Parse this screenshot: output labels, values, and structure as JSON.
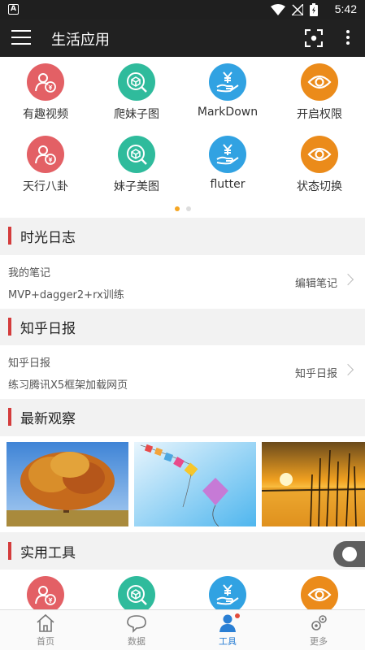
{
  "status_bar": {
    "time": "5:42",
    "app_badge": "A"
  },
  "app_bar": {
    "title": "生活应用"
  },
  "grid": {
    "items": [
      {
        "label": "有趣视频",
        "icon": "user-money-icon",
        "color": "#e36065"
      },
      {
        "label": "爬妹子图",
        "icon": "box-search-icon",
        "color": "#2fbb9c"
      },
      {
        "label": "MarkDown",
        "icon": "yen-hand-icon",
        "color": "#31a2e2"
      },
      {
        "label": "开启权限",
        "icon": "eye-icon",
        "color": "#eb8b1a"
      },
      {
        "label": "天行八卦",
        "icon": "user-money-icon",
        "color": "#e36065"
      },
      {
        "label": "妹子美图",
        "icon": "box-search-icon",
        "color": "#2fbb9c"
      },
      {
        "label": "flutter",
        "icon": "yen-hand-icon",
        "color": "#31a2e2"
      },
      {
        "label": "状态切换",
        "icon": "eye-icon",
        "color": "#eb8b1a"
      }
    ],
    "page_count": 2,
    "active_page": 1
  },
  "sections": {
    "diary": {
      "title": "时光日志",
      "line1": "我的笔记",
      "line2": "MVP+dagger2+rx训练",
      "action": "编辑笔记"
    },
    "zhihu": {
      "title": "知乎日报",
      "line1": "知乎日报",
      "line2": "练习腾讯X5框架加载网页",
      "action": "知乎日报"
    },
    "observe": {
      "title": "最新观察"
    },
    "tools": {
      "title": "实用工具"
    }
  },
  "bottom_nav": {
    "items": [
      {
        "label": "首页",
        "icon": "home-icon"
      },
      {
        "label": "数据",
        "icon": "chat-bubble-icon"
      },
      {
        "label": "工具",
        "icon": "person-icon"
      },
      {
        "label": "更多",
        "icon": "gears-icon"
      }
    ],
    "active_index": 2
  },
  "colors": {
    "accent": "#2a7fd4",
    "section_bar": "#d43c3c",
    "app_bar": "#212121"
  }
}
